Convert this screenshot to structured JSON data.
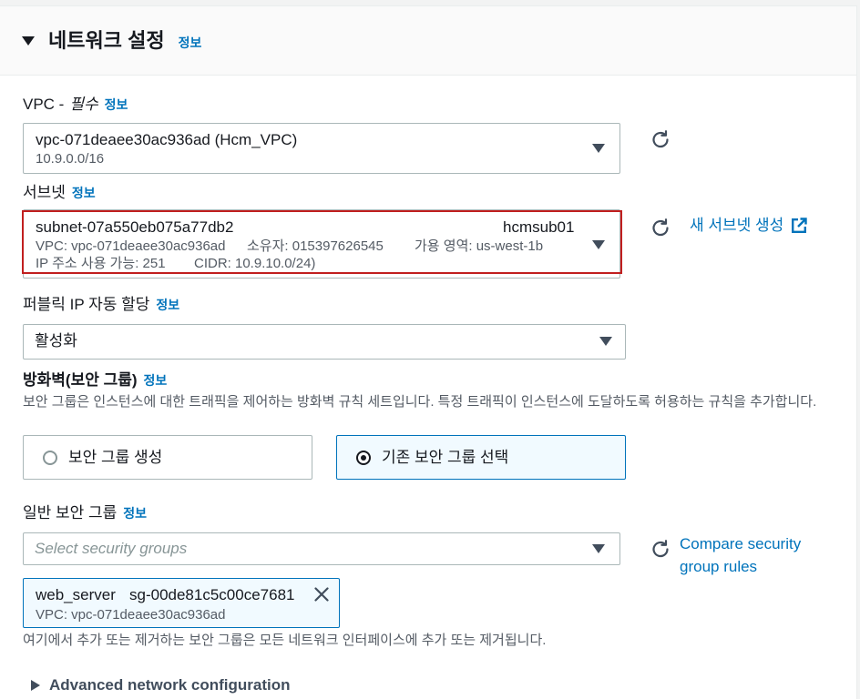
{
  "section": {
    "title": "네트워크 설정",
    "info_link": "정보",
    "expanded": true
  },
  "vpc": {
    "label": "VPC -",
    "required": "필수",
    "info_link": "정보",
    "selected_value": "vpc-071deaee30ac936ad (Hcm_VPC)",
    "selected_description": "10.9.0.0/16"
  },
  "subnet": {
    "label": "서브넷",
    "info_link": "정보",
    "selected_id": "subnet-07a550eb075a77db2",
    "selected_name": "hcmsub01",
    "vpc": "VPC: vpc-071deaee30ac936ad",
    "owner": "소유자: 015397626545",
    "availability_zone": "가용 영역: us-west-1b",
    "available_ips": "IP 주소 사용 가능: 251",
    "cidr": "CIDR: 10.9.10.0/24)",
    "create_link": "새 서브넷 생성"
  },
  "public_ip": {
    "label": "퍼블릭 IP 자동 할당",
    "info_link": "정보",
    "selected_value": "활성화"
  },
  "firewall": {
    "label": "방화벽(보안 그룹)",
    "info_link": "정보",
    "description": "보안 그룹은 인스턴스에 대한 트래픽을 제어하는 방화벽 규칙 세트입니다. 특정 트래픽이 인스턴스에 도달하도록 허용하는 규칙을 추가합니다.",
    "options": [
      {
        "label": "보안 그룹 생성",
        "selected": false
      },
      {
        "label": "기존 보안 그룹 선택",
        "selected": true
      }
    ]
  },
  "security_groups": {
    "label": "일반 보안 그룹",
    "info_link": "정보",
    "placeholder": "Select security groups",
    "compare_link": "Compare security group rules",
    "tokens": [
      {
        "name": "web_server",
        "id": "sg-00de81c5c00ce7681",
        "vpc": "VPC: vpc-071deaee30ac936ad"
      }
    ],
    "note": "여기에서 추가 또는 제거하는 보안 그룹은 모든 네트워크 인터페이스에 추가 또는 제거됩니다."
  },
  "advanced": {
    "label": "Advanced network configuration",
    "expanded": false
  },
  "icons": {
    "section_toggle": "caret-down-icon",
    "select_caret": "caret-down-icon",
    "refresh": "refresh-icon",
    "external_link": "external-link-icon",
    "radio": "radio-icon",
    "token_remove": "close-icon",
    "advanced_toggle": "caret-right-icon"
  },
  "colors": {
    "text": "#16191f",
    "secondary_text": "#545b64",
    "link": "#0073bb",
    "border": "#aab7b8",
    "placeholder": "#879596",
    "selected_bg": "#f1faff",
    "selected_border": "#0073bb",
    "header_bg": "#fafafa",
    "highlight_border": "#c11f1f"
  }
}
